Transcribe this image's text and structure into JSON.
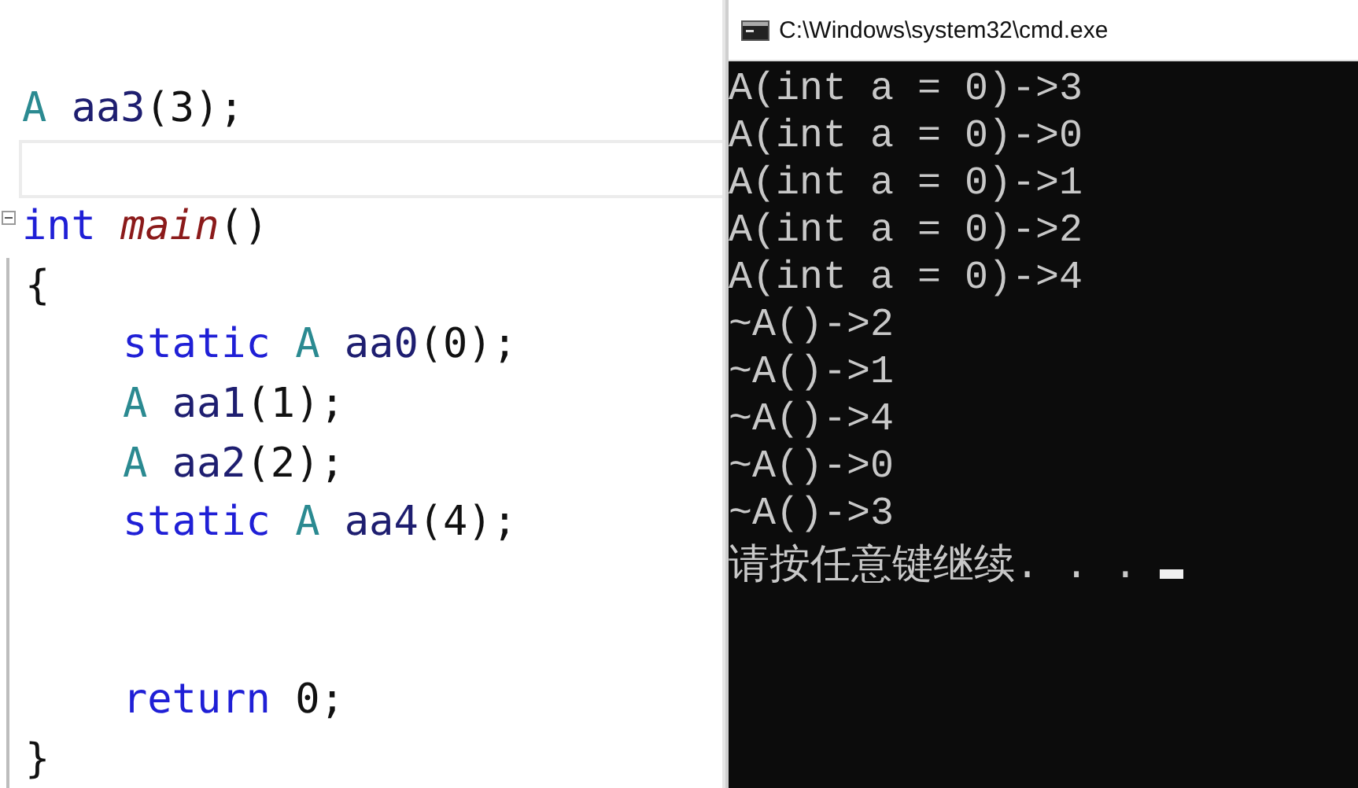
{
  "editor": {
    "lines": [
      {
        "kind": "code",
        "words": [
          [
            {
              "kind": "type",
              "text": "A"
            }
          ],
          [
            {
              "kind": "ident",
              "text": "aa3"
            },
            {
              "kind": "punct",
              "text": "(3);"
            }
          ]
        ]
      },
      {
        "kind": "current"
      },
      {
        "kind": "fold-start",
        "words": [
          [
            {
              "kind": "keyword",
              "text": "int"
            }
          ],
          [
            {
              "kind": "function",
              "text": "main"
            },
            {
              "kind": "punct",
              "text": "()"
            }
          ]
        ]
      },
      {
        "kind": "code",
        "words": [
          [
            {
              "kind": "punct",
              "text": "{"
            }
          ]
        ]
      },
      {
        "kind": "block",
        "children": [
          {
            "kind": "code",
            "words": [
              [
                {
                  "kind": "keyword",
                  "text": "static"
                }
              ],
              [
                {
                  "kind": "type",
                  "text": "A"
                }
              ],
              [
                {
                  "kind": "ident",
                  "text": "aa0"
                },
                {
                  "kind": "punct",
                  "text": "(0);"
                }
              ]
            ]
          },
          {
            "kind": "code",
            "words": [
              [
                {
                  "kind": "type",
                  "text": "A"
                }
              ],
              [
                {
                  "kind": "ident",
                  "text": "aa1"
                },
                {
                  "kind": "punct",
                  "text": "(1);"
                }
              ]
            ]
          },
          {
            "kind": "code",
            "words": [
              [
                {
                  "kind": "type",
                  "text": "A"
                }
              ],
              [
                {
                  "kind": "ident",
                  "text": "aa2"
                },
                {
                  "kind": "punct",
                  "text": "(2);"
                }
              ]
            ]
          },
          {
            "kind": "code",
            "words": [
              [
                {
                  "kind": "keyword",
                  "text": "static"
                }
              ],
              [
                {
                  "kind": "type",
                  "text": "A"
                }
              ],
              [
                {
                  "kind": "ident",
                  "text": "aa4"
                },
                {
                  "kind": "punct",
                  "text": "(4);"
                }
              ]
            ]
          },
          {
            "kind": "blank"
          },
          {
            "kind": "blank"
          },
          {
            "kind": "code",
            "words": [
              [
                {
                  "kind": "keyword",
                  "text": "return"
                }
              ],
              [
                {
                  "kind": "punct",
                  "text": "0;"
                }
              ]
            ]
          }
        ]
      },
      {
        "kind": "code",
        "words": [
          [
            {
              "kind": "punct",
              "text": "}"
            }
          ]
        ]
      }
    ]
  },
  "console": {
    "title": "C:\\Windows\\system32\\cmd.exe",
    "cursor": true,
    "lines": [
      "A(int a = 0)->3",
      "A(int a = 0)->0",
      "A(int a = 0)->1",
      "A(int a = 0)->2",
      "A(int a = 0)->4",
      "~A()->2",
      "~A()->1",
      "~A()->4",
      "~A()->0",
      "~A()->3",
      "请按任意键继续. . ."
    ]
  }
}
